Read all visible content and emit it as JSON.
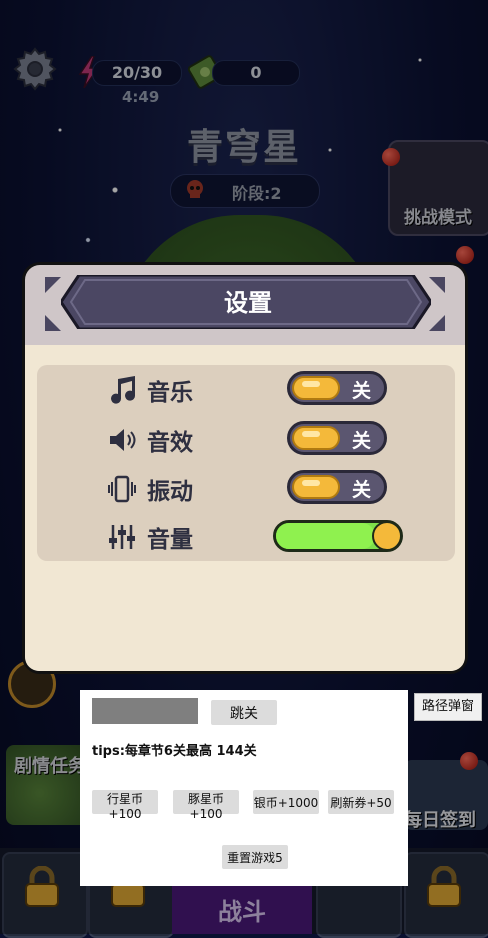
{
  "hud": {
    "energy": "20/30",
    "coins": "0",
    "timer": "4:49"
  },
  "planet": {
    "name": "青穹星",
    "stage": "阶段:2"
  },
  "buttons": {
    "challenge_mode": "挑战模式",
    "story_task": "剧情任务",
    "daily_signin": "每日签到",
    "fight": "战斗"
  },
  "settings": {
    "title": "设置",
    "rows": [
      {
        "label": "音乐",
        "icon": "music-note-icon",
        "state": "关"
      },
      {
        "label": "音效",
        "icon": "speaker-icon",
        "state": "关"
      },
      {
        "label": "振动",
        "icon": "vibration-icon",
        "state": "关"
      },
      {
        "label": "音量",
        "icon": "equalizer-icon",
        "level": 0.8
      }
    ],
    "toggle_color": "#f4b93a",
    "volume_color": "#8ff14f"
  },
  "debug": {
    "skip_label": "跳关",
    "tips": "tips:每章节6关最高 144关",
    "buttons": [
      "行星币+100",
      "豚星币+100",
      "银币+1000",
      "刷新券+50"
    ],
    "reset_label": "重置游戏5",
    "path_popup_label": "路径弹窗"
  }
}
